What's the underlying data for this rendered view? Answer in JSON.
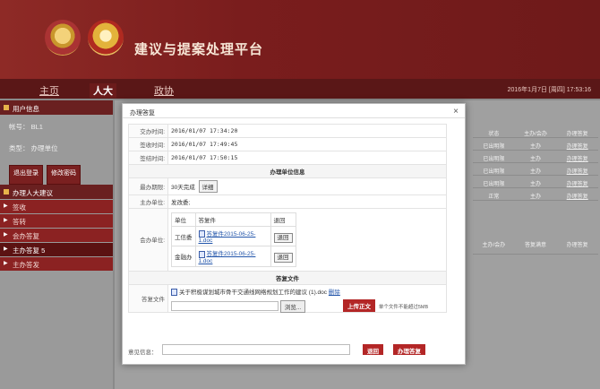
{
  "header": {
    "site_title": "建议与提案处理平台"
  },
  "nav": {
    "items": [
      "主页",
      "人大",
      "政协"
    ],
    "active": "人大",
    "datetime": "2016年1月7日 [周四] 17:53:16"
  },
  "sidebar": {
    "user_section_title": "用户信息",
    "account_label": "帐号：",
    "account_value": "BL1",
    "type_label": "类型：",
    "type_value": "办理单位",
    "logout_label": "退出登录",
    "change_password_label": "修改密码",
    "menu_section_title": "办理人大建议",
    "menu_items": [
      "签收",
      "答转",
      "会办答复",
      "主办答复 5",
      "主办答发"
    ]
  },
  "background_table": {
    "headers": [
      "状态",
      "主办/会办",
      "办理答复"
    ],
    "rows": [
      [
        "已出明限",
        "主办",
        "办理答复"
      ],
      [
        "已出明限",
        "主办",
        "办理答复"
      ],
      [
        "已出明限",
        "主办",
        "办理答复"
      ],
      [
        "已出明限",
        "主办",
        "办理答复"
      ],
      [
        "正常",
        "主办",
        "办理答复"
      ]
    ],
    "headers2": [
      "主办/会办",
      "答复满意",
      "办理答复"
    ]
  },
  "modal": {
    "title": "办理答复",
    "close_icon": "×",
    "rows": {
      "assign_time_label": "交办时间:",
      "assign_time": "2016/01/07 17:34:20",
      "sign_time_label": "签收时间:",
      "sign_time": "2016/01/07 17:49:45",
      "answer_time_label": "签结时间:",
      "answer_time": "2016/01/07 17:50:15",
      "handling_section": "办理单位信息",
      "deadline_label": "最办期限:",
      "deadline_value": "30天完成",
      "detail_label": "详细",
      "main_unit_label": "主办单位:",
      "main_unit_value": "发改委;",
      "co_unit_label": "会办单位:",
      "co_table_headers": [
        "单位",
        "答复件",
        "退回"
      ],
      "co_rows": [
        {
          "unit": "工信委",
          "file": "答复件2015-06-25-1.doc",
          "action": "退回"
        },
        {
          "unit": "金融办",
          "file": "答复件2015-06-25-1.doc",
          "action": "退回"
        }
      ],
      "reply_section": "答复文件",
      "reply_file_label": "答复文件",
      "reply_file_name": "关于积极谋划城市骨干交通线网络规划工作的建议 (1).doc",
      "delete_link": "删除",
      "browse_label": "浏览...",
      "upload_label": "上传正文",
      "size_limit": "单个文件不能超过5MB"
    },
    "footer": {
      "opinion_label": "意见信息：",
      "return_button": "退回",
      "submit_button": "办理答复"
    }
  }
}
